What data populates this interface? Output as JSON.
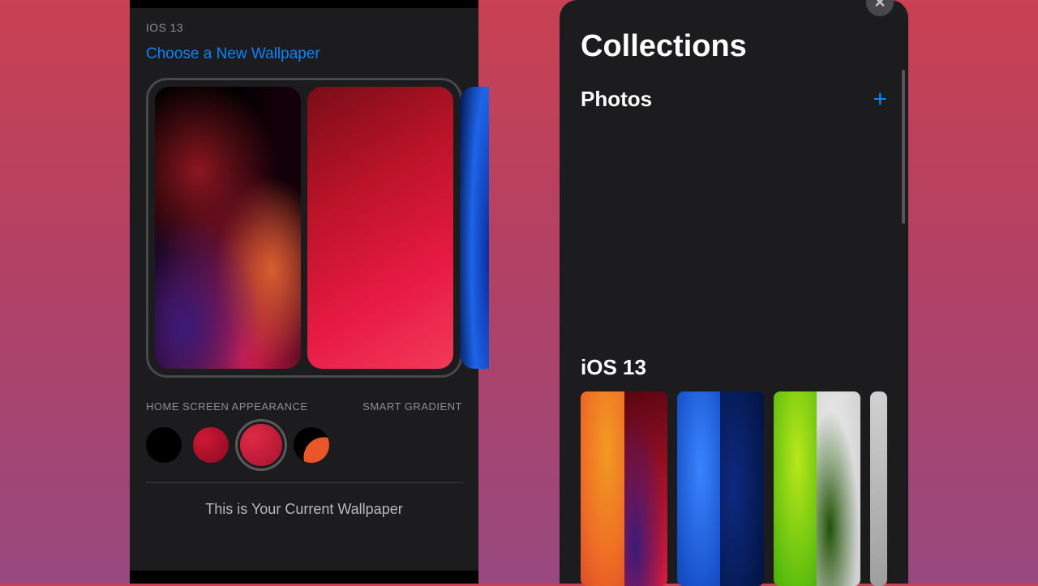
{
  "left": {
    "category_label": "IOS 13",
    "choose_link": "Choose a New Wallpaper",
    "home_screen_label": "HOME SCREEN APPEARANCE",
    "mode_label": "SMART GRADIENT",
    "current_label": "This is Your Current Wallpaper",
    "swatches": [
      {
        "name": "black"
      },
      {
        "name": "red-dark"
      },
      {
        "name": "red-bright",
        "selected": true
      },
      {
        "name": "half-swirl"
      }
    ]
  },
  "right": {
    "title": "Collections",
    "photos_label": "Photos",
    "add_glyph": "+",
    "close_glyph": "✕",
    "group_title": "iOS 13",
    "thumbs": [
      {
        "name": "ios13-red"
      },
      {
        "name": "ios13-blue"
      },
      {
        "name": "ios13-green"
      },
      {
        "name": "ios13-grey",
        "peek": true
      }
    ]
  }
}
